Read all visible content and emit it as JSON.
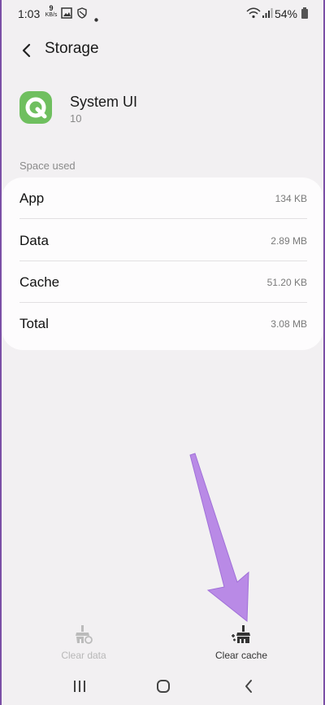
{
  "status_bar": {
    "time": "1:03",
    "net_speed_value": "9",
    "net_speed_unit": "KB/s",
    "battery_percent": "54%"
  },
  "header": {
    "title": "Storage"
  },
  "app": {
    "name": "System UI",
    "version": "10"
  },
  "section": {
    "label": "Space used"
  },
  "rows": [
    {
      "label": "App",
      "value": "134 KB"
    },
    {
      "label": "Data",
      "value": "2.89 MB"
    },
    {
      "label": "Cache",
      "value": "51.20 KB"
    },
    {
      "label": "Total",
      "value": "3.08 MB"
    }
  ],
  "actions": {
    "clear_data": {
      "label": "Clear data",
      "icon": "broom-clear-data-icon",
      "enabled": false
    },
    "clear_cache": {
      "label": "Clear cache",
      "icon": "broom-sparkle-icon",
      "enabled": true
    }
  },
  "colors": {
    "background": "#f2f0f2",
    "card": "#fdfcfd",
    "app_icon": "#6fbf5f",
    "annotation_arrow": "#b98ae6"
  }
}
